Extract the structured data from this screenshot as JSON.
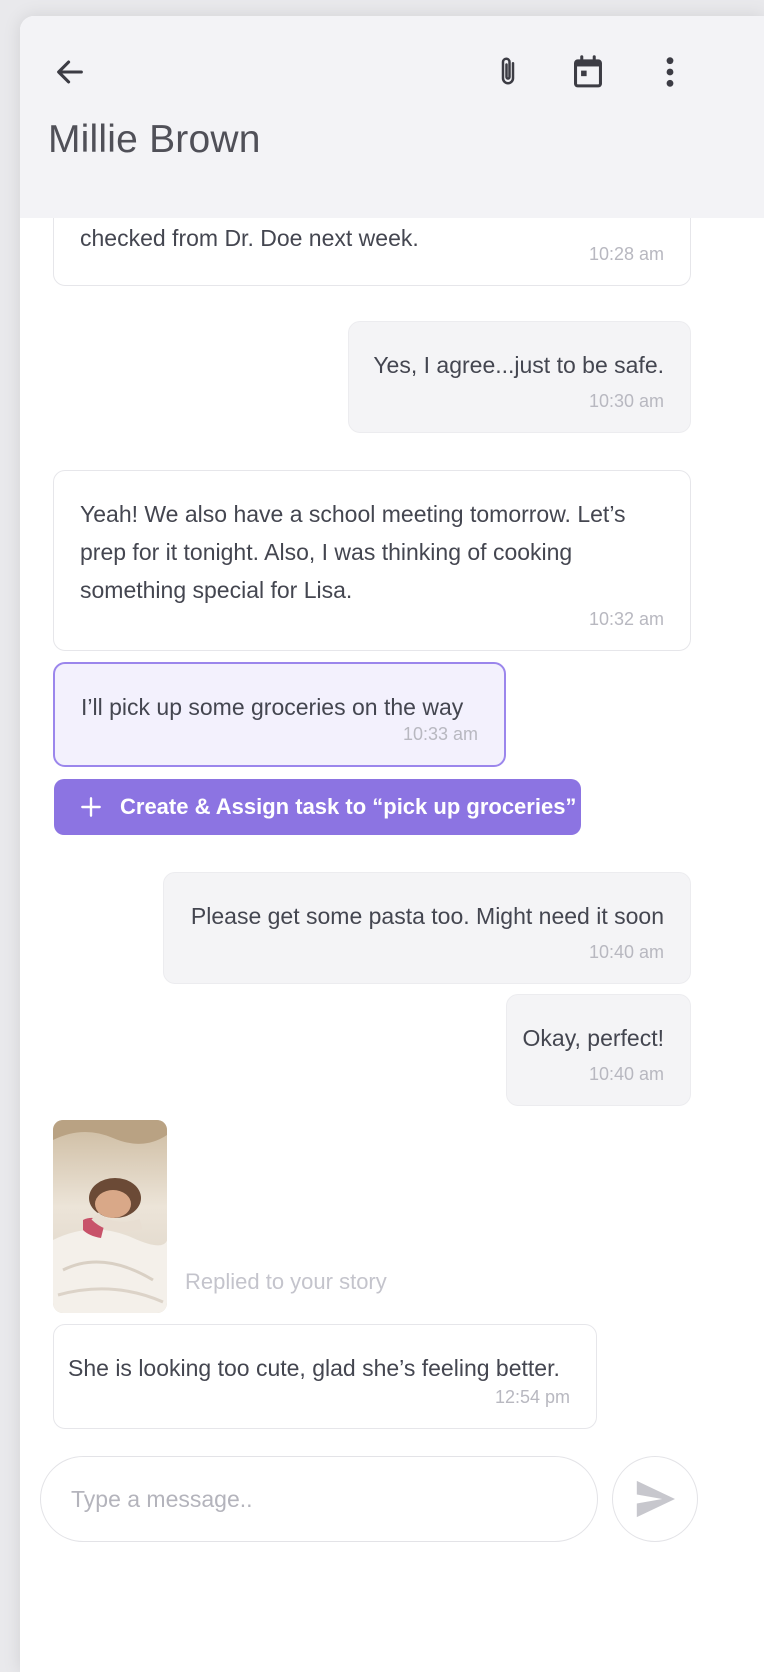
{
  "header": {
    "contact_name": "Millie Brown",
    "back_icon": "arrow-left-icon",
    "attach_icon": "paperclip-icon",
    "calendar_icon": "calendar-icon",
    "more_icon": "more-vertical-icon"
  },
  "messages": [
    {
      "direction": "received",
      "text": "checked from Dr. Doe next week.",
      "time": "10:28 am"
    },
    {
      "direction": "sent",
      "text": "Yes, I agree...just to be safe.",
      "time": "10:30 am"
    },
    {
      "direction": "received",
      "text": "Yeah! We also have a school meeting tomorrow. Let’s prep for it tonight. Also, I was thinking of cooking something special for Lisa.",
      "time": "10:32 am"
    },
    {
      "direction": "received",
      "text": "I’ll pick up some groceries on the way",
      "time": "10:33 am",
      "highlighted": true
    },
    {
      "direction": "sent",
      "text": "Please get some pasta too. Might need it soon",
      "time": "10:40 am"
    },
    {
      "direction": "sent",
      "text": "Okay, perfect!",
      "time": "10:40 am"
    },
    {
      "direction": "received",
      "text": "She is looking too cute, glad she’s feeling better.",
      "time": "12:54 pm"
    }
  ],
  "task_action": {
    "label": "Create & Assign task to “pick up groceries”",
    "icon": "plus-icon"
  },
  "story_reply": {
    "caption": "Replied to your story"
  },
  "composer": {
    "placeholder": "Type a message..",
    "value": "",
    "send_icon": "send-icon"
  },
  "colors": {
    "accent": "#8c74e2",
    "highlight_border": "#9b86ec",
    "header_bg": "#f3f3f6"
  }
}
